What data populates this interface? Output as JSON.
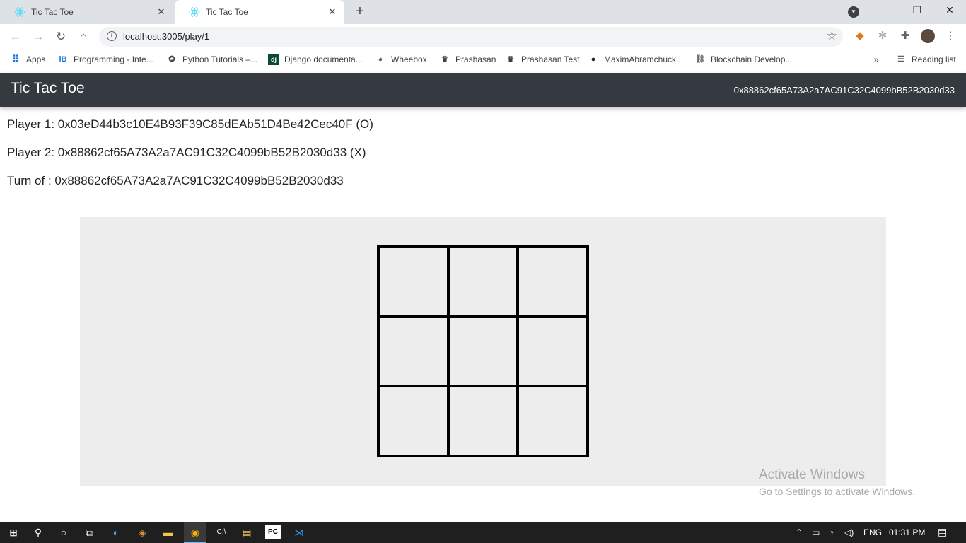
{
  "browser": {
    "tabs": [
      {
        "title": "Tic Tac Toe",
        "active": false
      },
      {
        "title": "Tic Tac Toe",
        "active": true
      }
    ],
    "url": "localhost:3005/play/1",
    "bookmarks": [
      {
        "label": "Apps",
        "icon": "apps-grid-icon"
      },
      {
        "label": "Programming - Inte...",
        "icon": "ib-icon"
      },
      {
        "label": "Python Tutorials –...",
        "icon": "python-icon"
      },
      {
        "label": "Django documenta...",
        "icon": "django-icon"
      },
      {
        "label": "Wheebox",
        "icon": "globe-icon"
      },
      {
        "label": "Prashasan",
        "icon": "emblem-icon"
      },
      {
        "label": "Prashasan Test",
        "icon": "emblem-icon"
      },
      {
        "label": "MaximAbramchuck...",
        "icon": "github-icon"
      },
      {
        "label": "Blockchain Develop...",
        "icon": "blockchain-icon"
      }
    ],
    "reading_list": "Reading list",
    "more_bookmarks": "»"
  },
  "app": {
    "brand": "Tic Tac Toe",
    "account": "0x88862cf65A73A2a7AC91C32C4099bB52B2030d33",
    "player1": "Player 1: 0x03eD44b3c10E4B93F39C85dEAb51D4Be42Cec40F (O)",
    "player2": "Player 2: 0x88862cf65A73A2a7AC91C32C4099bB52B2030d33 (X)",
    "turn": "Turn of : 0x88862cf65A73A2a7AC91C32C4099bB52B2030d33",
    "board": [
      "",
      "",
      "",
      "",
      "",
      "",
      "",
      "",
      ""
    ]
  },
  "watermark": {
    "title": "Activate Windows",
    "subtitle": "Go to Settings to activate Windows."
  },
  "taskbar": {
    "language": "ENG",
    "time": "01:31 PM"
  },
  "colors": {
    "navbar": "#343a40",
    "board_bg": "#ededed",
    "tabstrip": "#dee1e6"
  }
}
